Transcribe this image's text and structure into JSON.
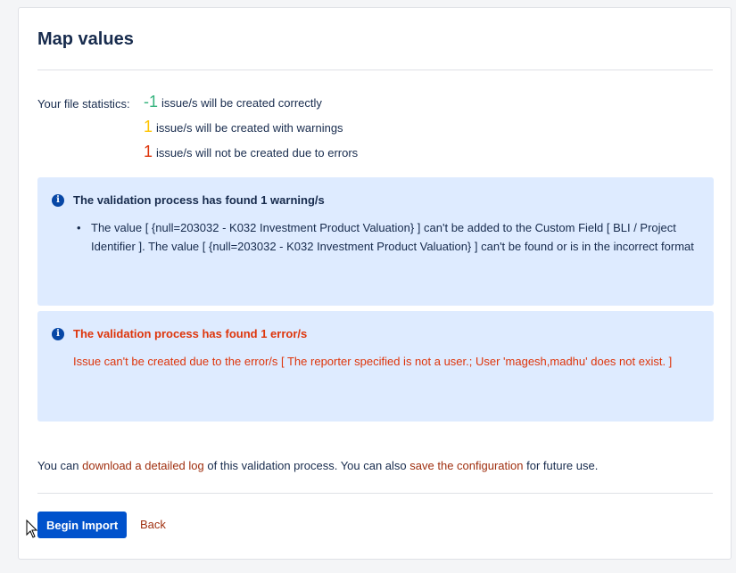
{
  "page": {
    "title": "Map values"
  },
  "stats": {
    "label": "Your file statistics:",
    "ok": {
      "count": "-1",
      "text": "issue/s will be created correctly"
    },
    "warn": {
      "count": "1",
      "text": "issue/s will be created with warnings"
    },
    "err": {
      "count": "1",
      "text": "issue/s will not be created due to errors"
    }
  },
  "warning_box": {
    "icon": "info-icon",
    "title": "The validation process has found 1 warning/s",
    "items": [
      "The value [ {null=203032 - K032 Investment Product Valuation} ] can't be added to the Custom Field [ BLI / Project Identifier ]. The value [ {null=203032 - K032 Investment Product Valuation} ] can't be found or is in the incorrect format"
    ]
  },
  "error_box": {
    "icon": "info-icon",
    "title": "The validation process has found 1 error/s",
    "message": "Issue can't be created due to the error/s [ The reporter specified is not a user.; User 'magesh,madhu' does not exist. ]"
  },
  "footer": {
    "prefix": "You can ",
    "download_link": "download a detailed log",
    "middle": " of this validation process. You can also ",
    "save_link": "save the configuration",
    "suffix": " for future use."
  },
  "actions": {
    "begin_import": "Begin Import",
    "back": "Back"
  },
  "colors": {
    "primary": "#0052cc",
    "success": "#36b37e",
    "warning": "#ffc400",
    "error": "#de350b",
    "info_bg": "#deebff"
  }
}
